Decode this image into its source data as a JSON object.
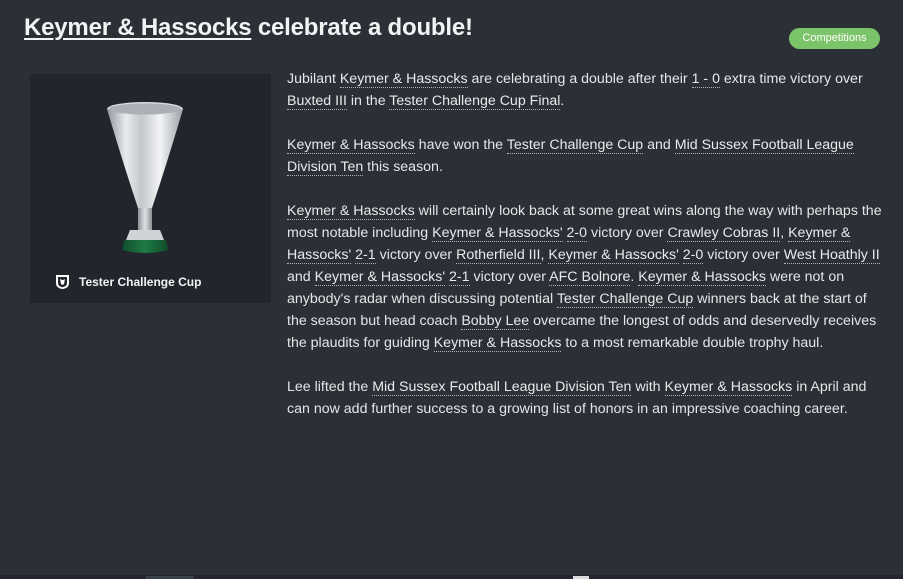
{
  "headline": {
    "club": "Keymer & Hassocks",
    "rest": " celebrate a double!"
  },
  "tag": {
    "label": "Competitions",
    "color": "#7cc46a"
  },
  "trophy": {
    "icon": "trophy-cup-icon",
    "competition_logo": "competition-crest-icon",
    "competition": "Tester Challenge Cup"
  },
  "article": {
    "p1": {
      "t1": "Jubilant ",
      "club": "Keymer & Hassocks",
      "t2": " are celebrating a double after their ",
      "score": "1 - 0",
      "t3": " extra time victory over ",
      "opponent": "Buxted III",
      "t4": " in the ",
      "cup_final": "Tester Challenge Cup Final",
      "t5": "."
    },
    "p2": {
      "club": "Keymer & Hassocks",
      "t1": " have won the ",
      "cup": "Tester Challenge Cup",
      "t2": " and ",
      "league": "Mid Sussex Football League Division Ten",
      "t3": " this season."
    },
    "p3": {
      "club": "Keymer & Hassocks",
      "t1": " will certainly look back at some great wins along the way with perhaps the most notable including ",
      "w1_club": "Keymer & Hassocks'",
      "t2": " ",
      "w1_score": "2-0",
      "t3": " victory over ",
      "w1_opp": "Crawley Cobras II",
      "t4": ", ",
      "w2_club": "Keymer & Hassocks'",
      "t5": " ",
      "w2_score": "2-1",
      "t6": " victory over ",
      "w2_opp": "Rotherfield III",
      "t7": ", ",
      "w3_club": "Keymer & Hassocks'",
      "t8": " ",
      "w3_score": "2-0",
      "t9": " victory over ",
      "w3_opp": "West Hoathly II",
      "t10": " and ",
      "w4_club": "Keymer & Hassocks'",
      "t11": " ",
      "w4_score": "2-1",
      "t12": " victory over ",
      "w4_opp": "AFC Bolnore",
      "t13": ". ",
      "club2": "Keymer & Hassocks",
      "t14": " were not on anybody's radar when discussing potential ",
      "cup": "Tester Challenge Cup",
      "t15": " winners back at the start of the season but head coach ",
      "coach": "Bobby Lee",
      "t16": " overcame the longest of odds and deservedly receives the plaudits for guiding ",
      "club3": "Keymer & Hassocks",
      "t17": " to a most remarkable double trophy haul."
    },
    "p4": {
      "t1": "Lee lifted the ",
      "league": "Mid Sussex Football League Division Ten",
      "t2": " with ",
      "club": "Keymer & Hassocks",
      "t3": " in April and can now add further success to a growing list of honors in an impressive coaching career."
    }
  }
}
